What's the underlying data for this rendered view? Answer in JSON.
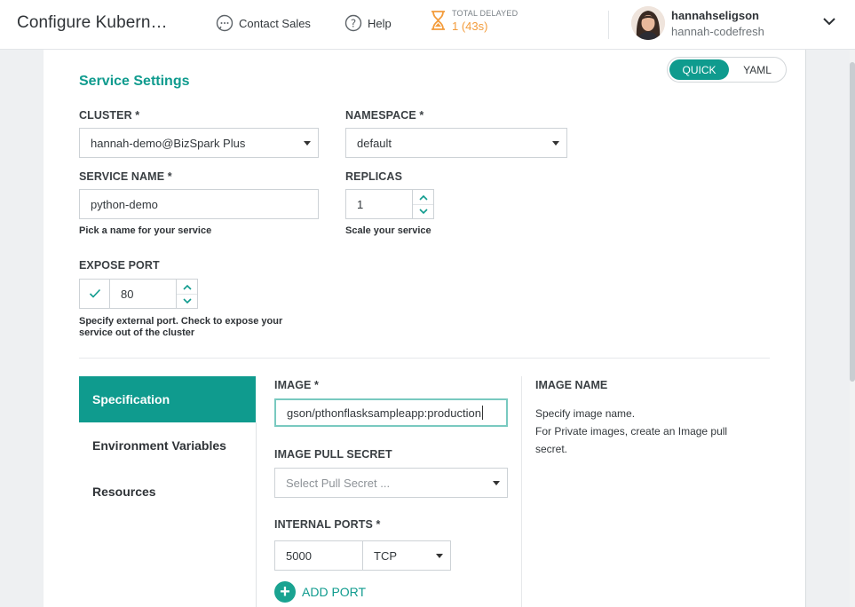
{
  "header": {
    "title": "Configure Kubern…",
    "contact_sales": "Contact Sales",
    "help": "Help",
    "timer_label": "TOTAL DELAYED",
    "timer_value": "1 (43s)",
    "user_name": "hannahseligson",
    "user_account": "hannah-codefresh"
  },
  "mode_toggle": {
    "quick": "QUICK",
    "yaml": "YAML",
    "selected": "QUICK"
  },
  "service_settings": {
    "title": "Service Settings",
    "cluster": {
      "label": "CLUSTER *",
      "value": "hannah-demo@BizSpark Plus"
    },
    "namespace": {
      "label": "NAMESPACE *",
      "value": "default"
    },
    "service_name": {
      "label": "SERVICE NAME *",
      "value": "python-demo",
      "hint": "Pick a name for your service"
    },
    "replicas": {
      "label": "REPLICAS",
      "value": "1",
      "hint": "Scale your service"
    },
    "expose_port": {
      "label": "EXPOSE PORT",
      "checked": true,
      "value": "80",
      "hint_line1": "Specify external port. Check to expose your",
      "hint_line2": "service out of the cluster"
    }
  },
  "side_tabs": [
    {
      "label": "Specification",
      "active": true
    },
    {
      "label": "Environment Variables",
      "active": false
    },
    {
      "label": "Resources",
      "active": false
    }
  ],
  "specification": {
    "image": {
      "label": "IMAGE *",
      "value": "gson/pthonflasksampleapp:production"
    },
    "image_pull_secret": {
      "label": "IMAGE PULL SECRET",
      "placeholder": "Select Pull Secret ..."
    },
    "internal_ports": {
      "label": "INTERNAL PORTS *",
      "port": "5000",
      "protocol": "TCP"
    },
    "add_port": "ADD PORT"
  },
  "image_info": {
    "title": "IMAGE NAME",
    "line1": "Specify image name.",
    "line2": "For Private images, create an Image pull",
    "line3": "secret."
  },
  "colors": {
    "accent": "#0f9b8e",
    "timer": "#f39c3c"
  }
}
